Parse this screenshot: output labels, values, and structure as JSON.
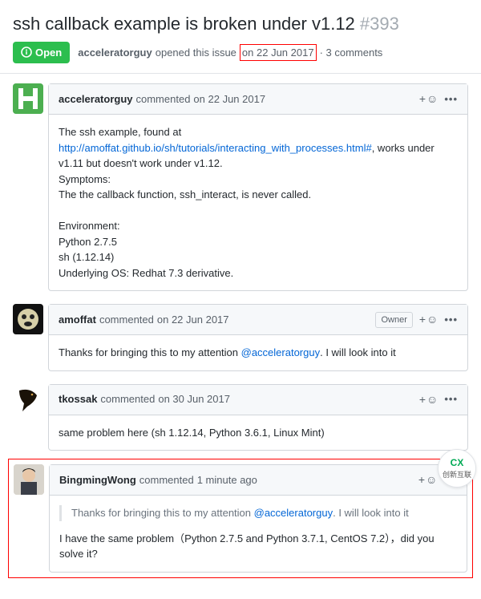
{
  "issue": {
    "title": "ssh callback example is broken under v1.12",
    "number": "#393",
    "state": "Open",
    "meta_author": "acceleratorguy",
    "meta_opened": " opened this issue ",
    "meta_date": "on 22 Jun 2017",
    "meta_comments": " · 3 comments"
  },
  "comments": [
    {
      "author": "acceleratorguy",
      "commented": " commented ",
      "time": "on 22 Jun 2017",
      "owner": false,
      "body_pre": "The ssh example, found at ",
      "body_link": "http://amoffat.github.io/sh/tutorials/interacting_with_processes.html#",
      "body_post": ", works under v1.11 but doesn't work under v1.12.",
      "lines": [
        "Symptoms:",
        "The the callback function, ssh_interact, is never called.",
        "",
        "Environment:",
        "Python 2.7.5",
        "sh (1.12.14)",
        "Underlying OS: Redhat 7.3 derivative."
      ]
    },
    {
      "author": "amoffat",
      "commented": " commented ",
      "time": "on 22 Jun 2017",
      "owner": true,
      "owner_label": "Owner",
      "body_pre": "Thanks for bringing this to my attention ",
      "mention": "@acceleratorguy",
      "body_post": ". I will look into it"
    },
    {
      "author": "tkossak",
      "commented": " commented ",
      "time": "on 30 Jun 2017",
      "owner": false,
      "body": "same problem here (sh 1.12.14, Python 3.6.1, Linux Mint)"
    },
    {
      "author": "BingmingWong",
      "commented": " commented ",
      "time": "1 minute ago",
      "owner": false,
      "quote_pre": "Thanks for bringing this to my attention ",
      "quote_mention": "@acceleratorguy",
      "quote_post": ". I will look into it",
      "body": "I have the same problem（Python 2.7.5 and Python 3.7.1, CentOS 7.2），did you solve it?"
    }
  ],
  "ui": {
    "plus": "+",
    "smiley": "☺",
    "kebab": "•••"
  },
  "watermark": {
    "top": "CX",
    "bottom": "创新互联"
  }
}
